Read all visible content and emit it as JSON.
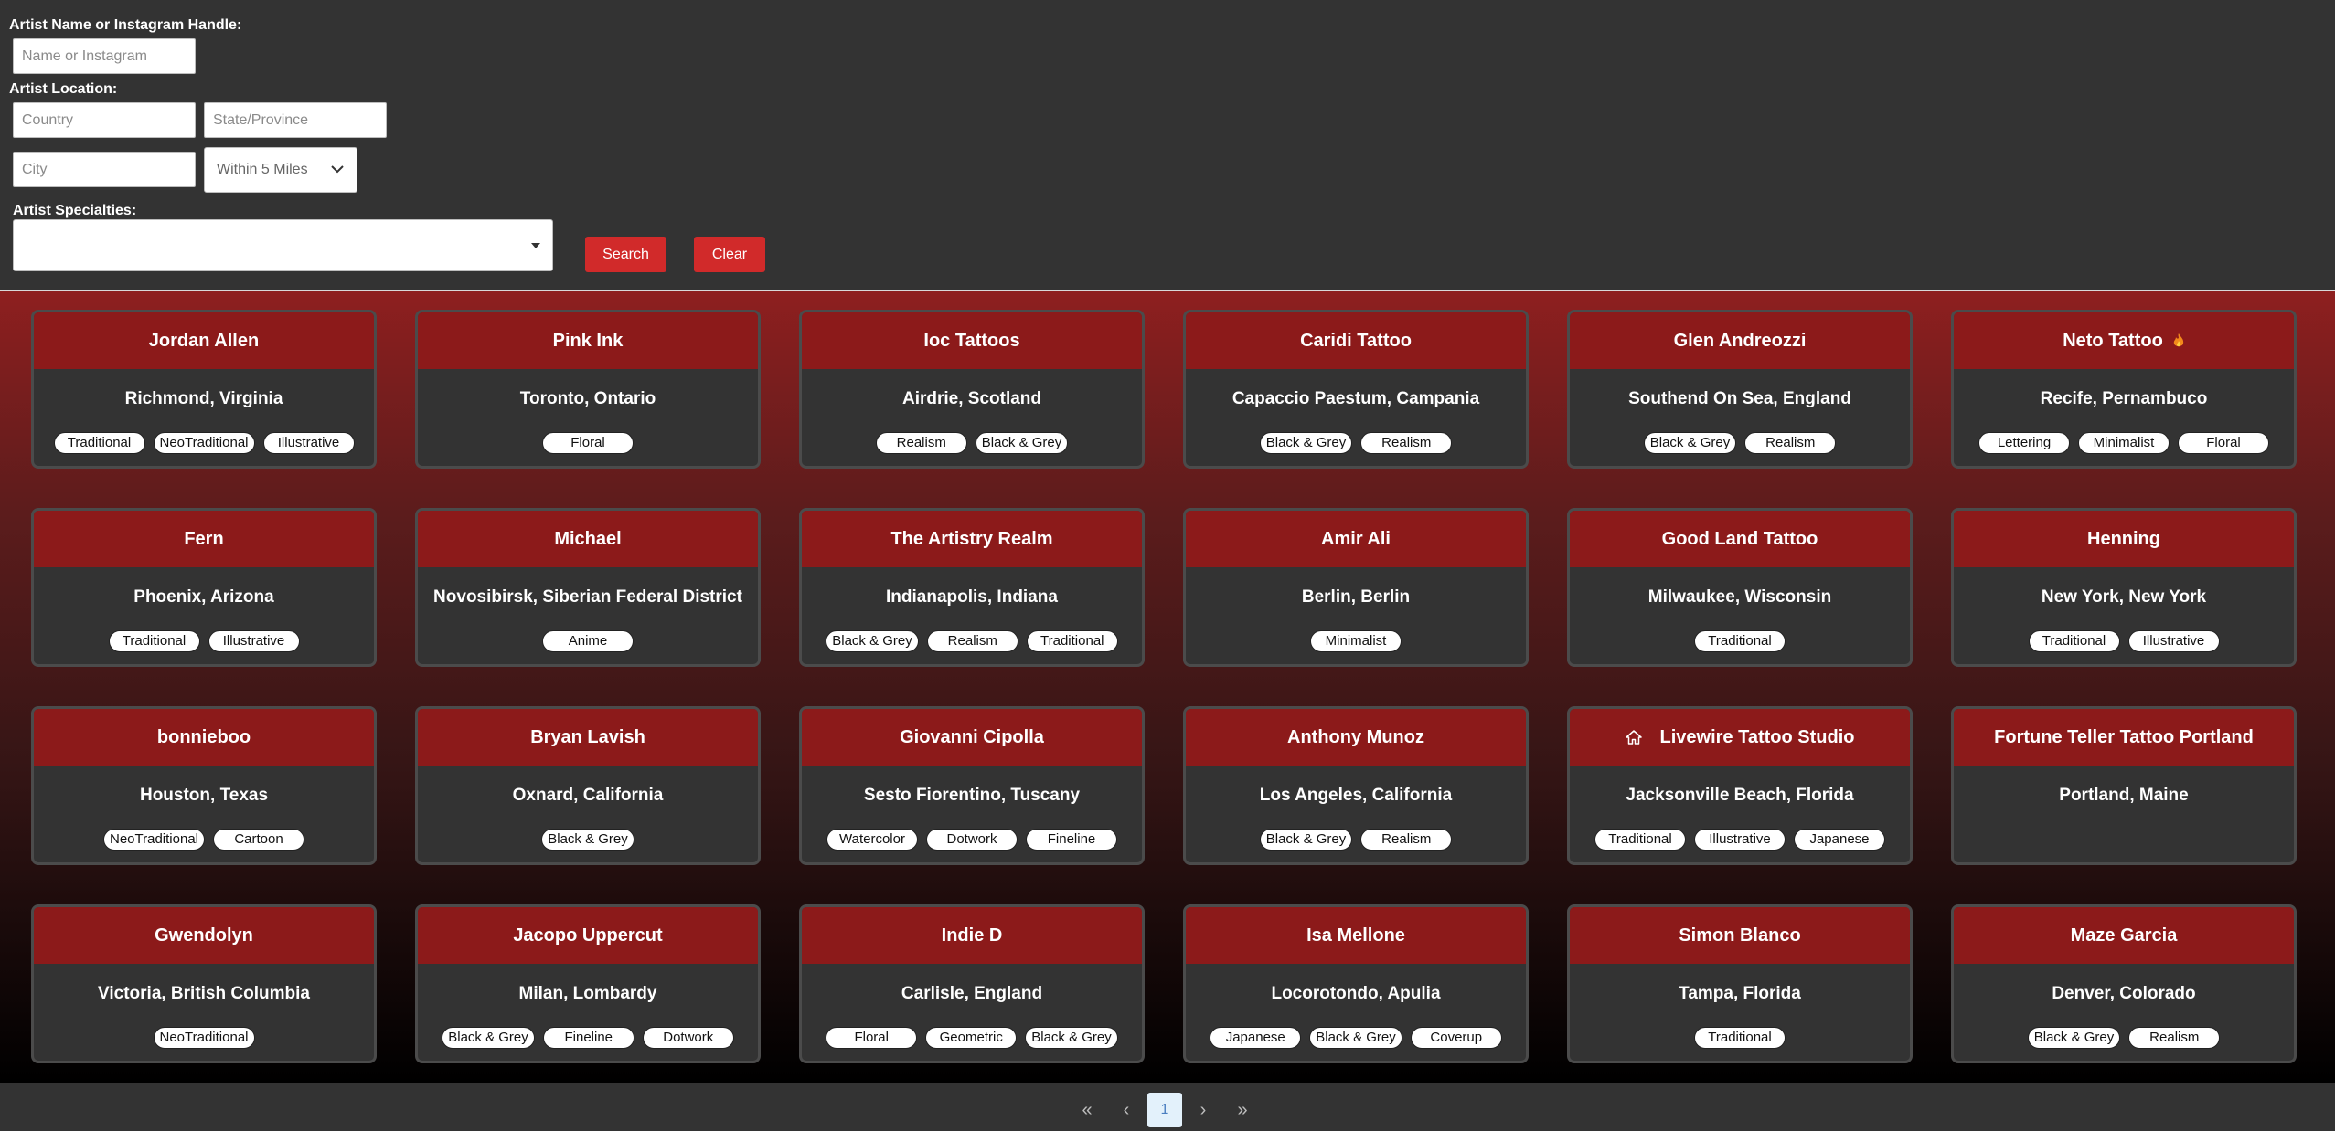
{
  "form": {
    "name_label": "Artist Name or Instagram Handle:",
    "name_placeholder": "Name or Instagram",
    "location_label": "Artist Location:",
    "country_placeholder": "Country",
    "state_placeholder": "State/Province",
    "city_placeholder": "City",
    "distance_value": "Within 5 Miles",
    "specialties_label": "Artist Specialties:",
    "search_label": "Search",
    "clear_label": "Clear"
  },
  "artists": [
    {
      "name": "Jordan Allen",
      "location": "Richmond, Virginia",
      "tags": [
        "Traditional",
        "NeoTraditional",
        "Illustrative"
      ]
    },
    {
      "name": "Pink Ink",
      "location": "Toronto, Ontario",
      "tags": [
        "Floral"
      ]
    },
    {
      "name": "Ioc Tattoos",
      "location": "Airdrie, Scotland",
      "tags": [
        "Realism",
        "Black & Grey"
      ]
    },
    {
      "name": "Caridi Tattoo",
      "location": "Capaccio Paestum, Campania",
      "tags": [
        "Black & Grey",
        "Realism"
      ]
    },
    {
      "name": "Glen Andreozzi",
      "location": "Southend On Sea, England",
      "tags": [
        "Black & Grey",
        "Realism"
      ]
    },
    {
      "name": "Neto Tattoo",
      "icon": "flame-icon",
      "location": "Recife, Pernambuco",
      "tags": [
        "Lettering",
        "Minimalist",
        "Floral"
      ]
    },
    {
      "name": "Fern",
      "location": "Phoenix, Arizona",
      "tags": [
        "Traditional",
        "Illustrative"
      ]
    },
    {
      "name": "Michael",
      "location": "Novosibirsk, Siberian Federal District",
      "tags": [
        "Anime"
      ]
    },
    {
      "name": "The Artistry Realm",
      "location": "Indianapolis, Indiana",
      "tags": [
        "Black & Grey",
        "Realism",
        "Traditional"
      ]
    },
    {
      "name": "Amir Ali",
      "location": "Berlin, Berlin",
      "tags": [
        "Minimalist"
      ]
    },
    {
      "name": "Good Land Tattoo",
      "location": "Milwaukee, Wisconsin",
      "tags": [
        "Traditional"
      ]
    },
    {
      "name": "Henning",
      "location": "New York, New York",
      "tags": [
        "Traditional",
        "Illustrative"
      ]
    },
    {
      "name": "bonnieboo",
      "location": "Houston, Texas",
      "tags": [
        "NeoTraditional",
        "Cartoon"
      ]
    },
    {
      "name": "Bryan Lavish",
      "location": "Oxnard, California",
      "tags": [
        "Black & Grey"
      ]
    },
    {
      "name": "Giovanni Cipolla",
      "location": "Sesto Fiorentino, Tuscany",
      "tags": [
        "Watercolor",
        "Dotwork",
        "Fineline"
      ]
    },
    {
      "name": "Anthony Munoz",
      "location": "Los Angeles, California",
      "tags": [
        "Black & Grey",
        "Realism"
      ]
    },
    {
      "name": "Livewire Tattoo Studio",
      "icon": "home-icon",
      "location": "Jacksonville Beach, Florida",
      "tags": [
        "Traditional",
        "Illustrative",
        "Japanese"
      ]
    },
    {
      "name": "Fortune Teller Tattoo Portland",
      "location": "Portland, Maine",
      "tags": []
    },
    {
      "name": "Gwendolyn",
      "location": "Victoria, British Columbia",
      "tags": [
        "NeoTraditional"
      ]
    },
    {
      "name": "Jacopo Uppercut",
      "location": "Milan, Lombardy",
      "tags": [
        "Black & Grey",
        "Fineline",
        "Dotwork"
      ]
    },
    {
      "name": "Indie D",
      "location": "Carlisle, England",
      "tags": [
        "Floral",
        "Geometric",
        "Black & Grey"
      ]
    },
    {
      "name": "Isa Mellone",
      "location": "Locorotondo, Apulia",
      "tags": [
        "Japanese",
        "Black & Grey",
        "Coverup"
      ]
    },
    {
      "name": "Simon Blanco",
      "location": "Tampa, Florida",
      "tags": [
        "Traditional"
      ]
    },
    {
      "name": "Maze Garcia",
      "location": "Denver, Colorado",
      "tags": [
        "Black & Grey",
        "Realism"
      ]
    }
  ],
  "pagination": {
    "first": "«",
    "prev": "‹",
    "current": "1",
    "next": "›",
    "last": "»"
  },
  "colors": {
    "accent": "#d12a2a",
    "card_header": "#8c1a1a",
    "background": "#333333"
  }
}
